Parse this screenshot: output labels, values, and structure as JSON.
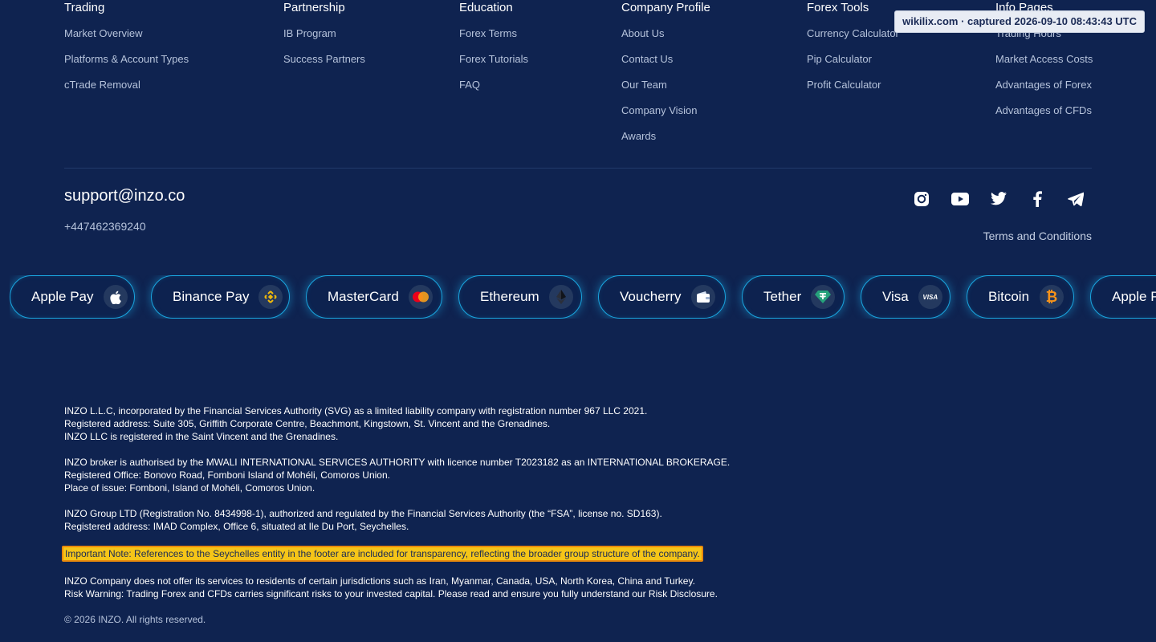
{
  "columns": [
    {
      "title": "Trading",
      "items": [
        "Market Overview",
        "Platforms & Account Types",
        "cTrade Removal"
      ]
    },
    {
      "title": "Partnership",
      "items": [
        "IB Program",
        "Success Partners"
      ]
    },
    {
      "title": "Education",
      "items": [
        "Forex Terms",
        "Forex Tutorials",
        "FAQ"
      ]
    },
    {
      "title": "Company Profile",
      "items": [
        "About Us",
        "Contact Us",
        "Our Team",
        "Company Vision",
        "Awards"
      ]
    },
    {
      "title": "Forex Tools",
      "items": [
        "Currency Calculator",
        "Pip Calculator",
        "Profit Calculator"
      ]
    },
    {
      "title": "Info Pages",
      "items": [
        "Trading Hours",
        "Market Access Costs",
        "Advantages of Forex",
        "Advantages of CFDs"
      ]
    }
  ],
  "contact": {
    "email": "support@inzo.co",
    "phone": "+447462369240"
  },
  "socials": [
    "instagram-icon",
    "youtube-icon",
    "twitter-icon",
    "facebook-icon",
    "telegram-icon"
  ],
  "terms": "Terms and Conditions",
  "payments": [
    {
      "label": "Apple Pay",
      "icon": "apple-icon"
    },
    {
      "label": "Binance Pay",
      "icon": "binance-icon"
    },
    {
      "label": "MasterCard",
      "icon": "mastercard-icon"
    },
    {
      "label": "Ethereum",
      "icon": "ethereum-icon"
    },
    {
      "label": "Voucherry",
      "icon": "wallet-icon"
    },
    {
      "label": "Tether",
      "icon": "tether-icon"
    },
    {
      "label": "Visa",
      "icon": "visa-icon",
      "icon_text": "VISA"
    },
    {
      "label": "Bitcoin",
      "icon": "bitcoin-icon",
      "icon_text": "₿"
    },
    {
      "label": "Apple Pay",
      "icon": "apple-icon"
    }
  ],
  "legal": {
    "p1": [
      "INZO L.L.C, incorporated by the Financial Services Authority (SVG) as a limited liability company with registration number 967 LLC 2021.",
      "Registered address: Suite 305, Griffith Corporate Centre, Beachmont, Kingstown, St. Vincent and the Grenadines.",
      "INZO LLC is registered in the Saint Vincent and the Grenadines."
    ],
    "p2": [
      "INZO broker is authorised by the MWALI INTERNATIONAL SERVICES AUTHORITY with licence number T2023182 as an INTERNATIONAL BROKERAGE.",
      "Registered Office: Bonovo Road, Fomboni Island of Mohéli, Comoros Union.",
      "Place of issue: Fomboni, Island of Mohéli, Comoros Union."
    ],
    "p3": [
      "INZO Group LTD (Registration No. 8434998-1), authorized and regulated by the Financial Services Authority (the “FSA”, license no. SD163).",
      "Registered address: IMAD Complex, Office 6, situated at Ile Du Port, Seychelles."
    ],
    "note": "Important Note: References to the Seychelles entity in the footer are included for transparency, reflecting the broader group structure of the company.",
    "p4": [
      "INZO Company does not offer its services to residents of certain jurisdictions such as Iran, Myanmar, Canada, USA, North Korea, China and Turkey.",
      "Risk Warning: Trading Forex and CFDs carries significant risks to your invested capital. Please read and ensure you fully understand our Risk Disclosure."
    ]
  },
  "copyright": "© 2026 INZO. All rights reserved.",
  "capture": "wikilix.com · captured 2026-09-10 08:43:43 UTC",
  "colors": {
    "background": "#0f2350",
    "pill_border": "#1aa6e0",
    "note_highlight": "#f5c518"
  }
}
